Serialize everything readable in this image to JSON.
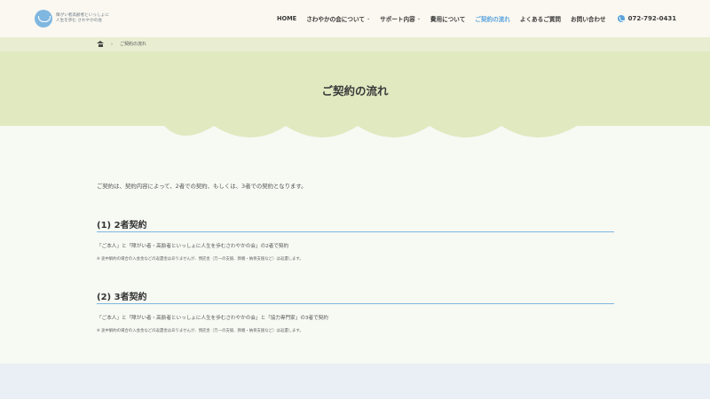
{
  "header": {
    "logo_line1": "障がい者高齢者といっしょに",
    "logo_line2": "人生を歩む さわやかの会",
    "nav": [
      {
        "label": "HOME",
        "has_dropdown": false,
        "active": false
      },
      {
        "label": "さわやかの会について",
        "has_dropdown": true,
        "active": false
      },
      {
        "label": "サポート内容",
        "has_dropdown": true,
        "active": false
      },
      {
        "label": "費用について",
        "has_dropdown": false,
        "active": false
      },
      {
        "label": "ご契約の流れ",
        "has_dropdown": false,
        "active": true
      },
      {
        "label": "よくあるご質問",
        "has_dropdown": false,
        "active": false
      },
      {
        "label": "お問い合わせ",
        "has_dropdown": false,
        "active": false
      }
    ],
    "phone": "072-792-0431"
  },
  "breadcrumb": {
    "separator": "›",
    "current": "ご契約の流れ"
  },
  "page": {
    "title": "ご契約の流れ"
  },
  "content": {
    "intro": "ご契約は、契約内容によって、2者での契約、もしくは、3者での契約となります。",
    "sections": [
      {
        "heading": "(1) 2者契約",
        "text": "「ご本人」と「障がい者・高齢者といっしょに人生を歩むさわやかの会」の2者で契約",
        "note": "※ 途中解約の場合の入会金などの返還金はありませんが、預託金（万一の支援、葬儀・納骨支援など）は返還します。"
      },
      {
        "heading": "(2) 3者契約",
        "text": "「ご本人」と「障がい者・高齢者といっしょに人生を歩むさわやかの会」と「協力専門家」の3者で契約",
        "note": "※ 途中解約の場合の入会金などの返還金はありませんが、預託金（万一の支援、葬儀・納骨支援など）は返還します。"
      }
    ]
  },
  "colors": {
    "accent": "#5aa3dd",
    "title_band": "#e1e9c1",
    "crumb_band": "#e9eed3",
    "header_bg": "#fbf8f1",
    "rule": "#7fb7e0"
  },
  "icons": {
    "logo": "logo-mark",
    "phone": "phone-icon",
    "home": "home-icon",
    "dropdown": "chevron-down-icon"
  }
}
